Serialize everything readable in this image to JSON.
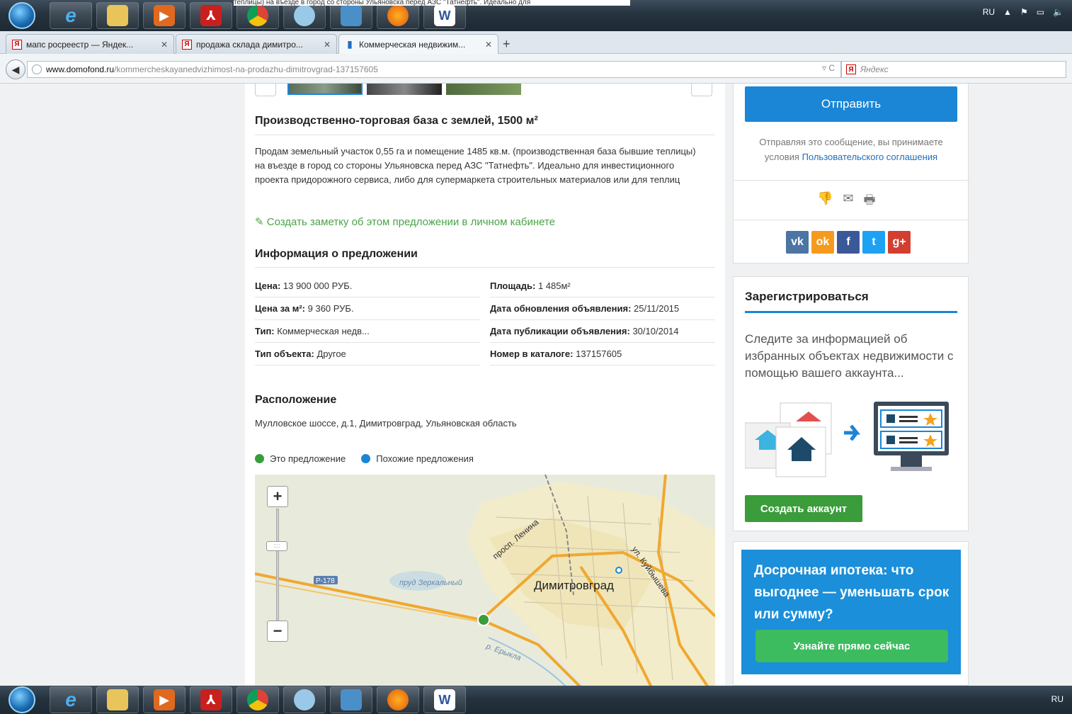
{
  "os": {
    "tray_lang": "RU",
    "tray_lang_bottom": "RU",
    "top_strip_text": "теплицы) на въезде в город со стороны Ульяновска перед АЗС \"Татнефть\". Идеально для"
  },
  "browser": {
    "tabs": [
      {
        "label": "мапс росреестр — Яндек...",
        "icon": "yandex-icon"
      },
      {
        "label": "продажа склада димитро...",
        "icon": "yandex-icon"
      },
      {
        "label": "Коммерческая недвижим...",
        "icon": "bookmark-icon"
      }
    ],
    "url_host": "www.domofond.ru",
    "url_path": "/kommercheskayanedvizhimost-na-prodazhu-dimitrovgrad-137157605",
    "search_placeholder": "Яндекс"
  },
  "listing": {
    "title": "Производственно-торговая база с землей, 1500 м²",
    "description": "Продам земельный участок 0,55 га и помещение 1485 кв.м. (производственная база бывшие теплицы) на въезде в город со стороны Ульяновска перед АЗС \"Татнефть\". Идеально для инвестиционного проекта придорожного сервиса, либо для супермаркета строительных материалов или для теплиц",
    "note_link": "Создать заметку об этом предложении в личном кабинете",
    "info_title": "Информация о предложении",
    "info_left": [
      {
        "label": "Цена:",
        "value": "13 900 000 РУБ."
      },
      {
        "label": "Цена за м²:",
        "value": "9 360 РУБ."
      },
      {
        "label": "Тип:",
        "value": "Коммерческая недв..."
      },
      {
        "label": "Тип объекта:",
        "value": "Другое"
      }
    ],
    "info_right": [
      {
        "label": "Площадь:",
        "value": "1 485м²"
      },
      {
        "label": "Дата обновления объявления:",
        "value": "25/11/2015"
      },
      {
        "label": "Дата публикации объявления:",
        "value": "30/10/2014"
      },
      {
        "label": "Номер в каталоге:",
        "value": "137157605"
      }
    ],
    "location_title": "Расположение",
    "address": "Мулловское шоссе, д.1, Димитровград, Ульяновская область",
    "legend_this": "Это предложение",
    "legend_similar": "Похожие предложения",
    "map": {
      "city": "Димитровград",
      "road_badge": "Р-178",
      "pond": "пруд Зеркальный",
      "street1": "просп. Ленина",
      "street2": "ул. Куйбышева",
      "river": "р. Ерыкла",
      "zoom_in": "+",
      "zoom_out": "−",
      "knob": "::::"
    }
  },
  "sidebar": {
    "send_label": "Отправить",
    "terms_prefix": "Отправляя это сообщение, вы принимаете условия",
    "terms_link": "Пользовательского соглашения",
    "social": [
      "vk",
      "ok",
      "f",
      "t",
      "g+"
    ],
    "register_title": "Зарегистрироваться",
    "register_text": "Следите за информацией об избранных объектах недвижимости с помощью вашего аккаунта...",
    "create_account": "Создать аккаунт",
    "promo_title": "Досрочная ипотека: что выгоднее — уменьшать срок или сумму?",
    "promo_button": "Узнайте прямо сейчас"
  },
  "colors": {
    "accent_blue": "#1b85d6",
    "green": "#3a9c3a",
    "this_dot": "#3a9c3a",
    "similar_dot": "#1b85d6"
  }
}
